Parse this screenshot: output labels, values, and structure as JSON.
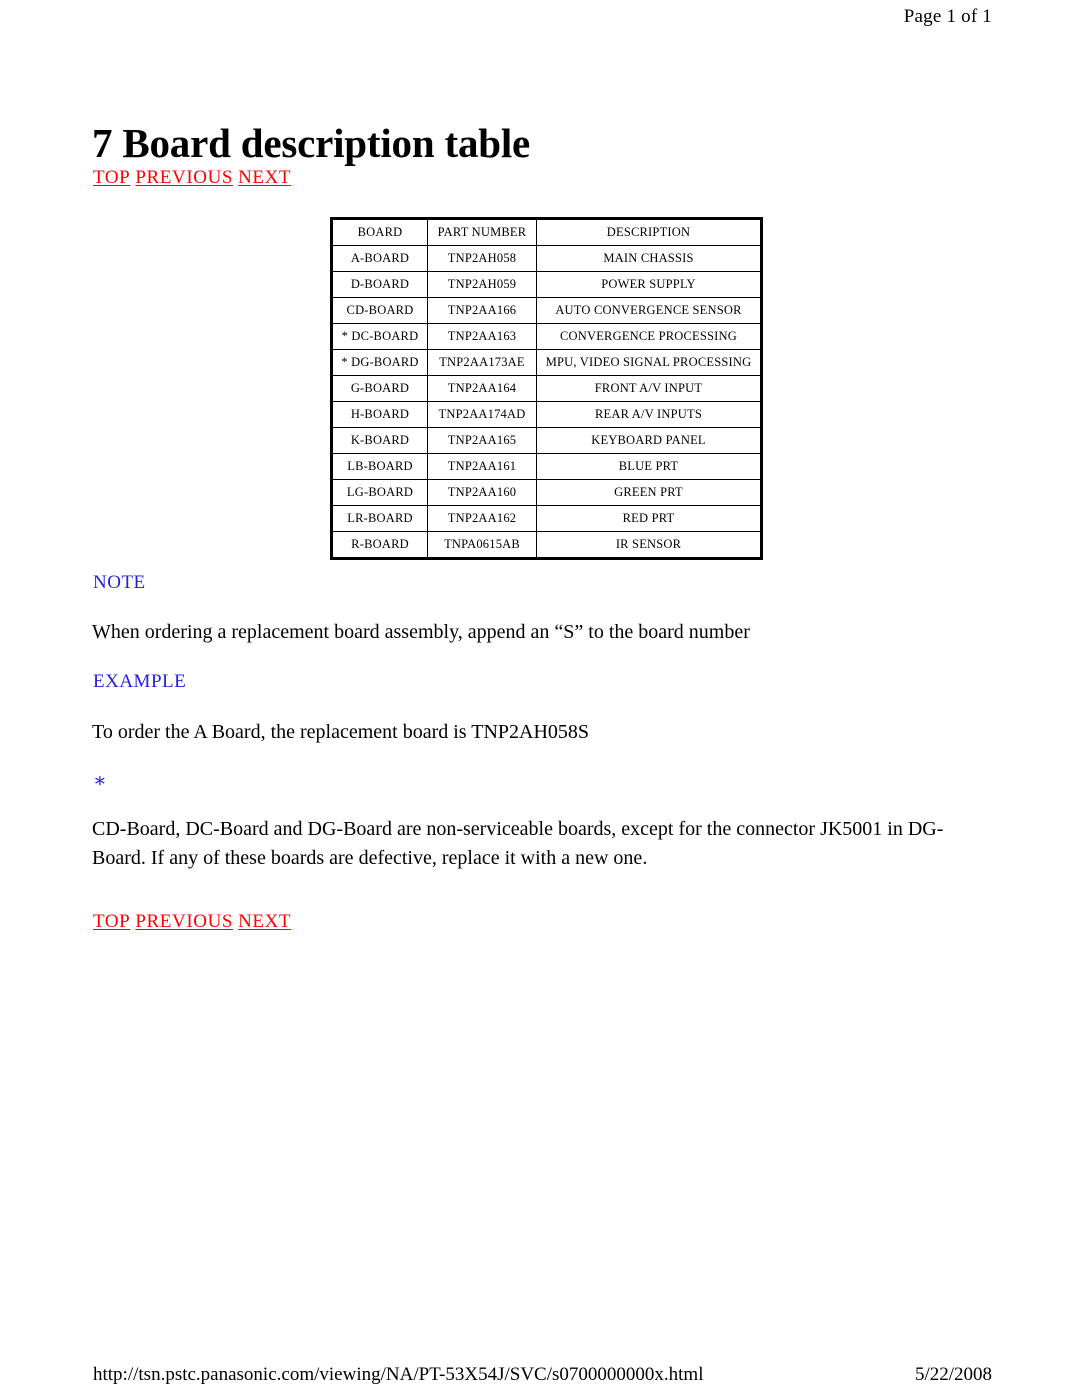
{
  "header": {
    "page_indicator": "Page 1 of 1"
  },
  "title": "7 Board description table",
  "nav": {
    "top": {
      "label": "TOP",
      "previous": "PREVIOUS",
      "next": "NEXT"
    },
    "bottom": {
      "label": "TOP",
      "previous": "PREVIOUS",
      "next": "NEXT"
    }
  },
  "table": {
    "columns": [
      "BOARD",
      "PART NUMBER",
      "DESCRIPTION"
    ],
    "rows": [
      {
        "board": "A-BOARD",
        "part": "TNP2AH058",
        "description": "MAIN CHASSIS"
      },
      {
        "board": "D-BOARD",
        "part": "TNP2AH059",
        "description": "POWER SUPPLY"
      },
      {
        "board": "CD-BOARD",
        "part": "TNP2AA166",
        "description": "AUTO CONVERGENCE SENSOR"
      },
      {
        "board": "* DC-BOARD",
        "part": "TNP2AA163",
        "description": "CONVERGENCE PROCESSING"
      },
      {
        "board": "* DG-BOARD",
        "part": "TNP2AA173AE",
        "description": "MPU, VIDEO SIGNAL PROCESSING"
      },
      {
        "board": "G-BOARD",
        "part": "TNP2AA164",
        "description": "FRONT A/V INPUT"
      },
      {
        "board": "H-BOARD",
        "part": "TNP2AA174AD",
        "description": "REAR A/V INPUTS"
      },
      {
        "board": "K-BOARD",
        "part": "TNP2AA165",
        "description": "KEYBOARD PANEL"
      },
      {
        "board": "LB-BOARD",
        "part": "TNP2AA161",
        "description": "BLUE PRT"
      },
      {
        "board": "LG-BOARD",
        "part": "TNP2AA160",
        "description": "GREEN PRT"
      },
      {
        "board": "LR-BOARD",
        "part": "TNP2AA162",
        "description": "RED PRT"
      },
      {
        "board": "R-BOARD",
        "part": "TNPA0615AB",
        "description": "IR SENSOR"
      }
    ]
  },
  "note": {
    "label": "NOTE",
    "text": "When ordering a replacement board assembly, append an “S” to the board number"
  },
  "example": {
    "label": "EXAMPLE",
    "text": "To order the A Board, the replacement board is TNP2AH058S"
  },
  "footnote": {
    "marker": "∗",
    "text": "CD-Board, DC-Board and DG-Board are non-serviceable boards, except for the connector JK5001 in DG-Board. If any of these boards are defective, replace it with a new one."
  },
  "footer": {
    "url": "http://tsn.pstc.panasonic.com/viewing/NA/PT-53X54J/SVC/s0700000000x.html",
    "date": "5/22/2008"
  },
  "colors": {
    "link_red": "#ff0000",
    "label_blue": "#2222dd",
    "text_black": "#000000",
    "page_background": "#ffffff"
  }
}
